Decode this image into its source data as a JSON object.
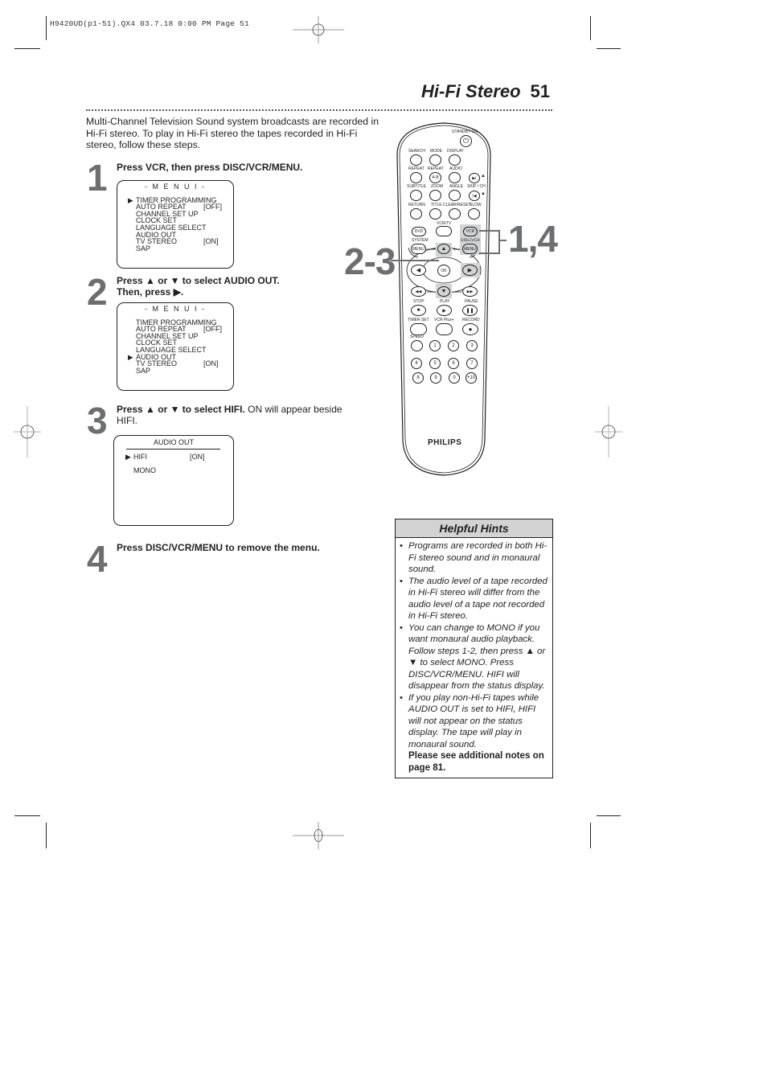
{
  "slug": "H9420UD(p1-51).QX4  03.7.18  0:00 PM  Page 51",
  "header": {
    "title": "Hi-Fi Stereo",
    "page_number": "51"
  },
  "intro": "Multi-Channel Television Sound system broadcasts are recorded in Hi-Fi stereo. To play in Hi-Fi stereo the tapes recorded in Hi-Fi stereo, follow these steps.",
  "steps": [
    {
      "number": "1",
      "text_bold": "Press VCR, then press DISC/VCR/MENU.",
      "text_normal": ""
    },
    {
      "number": "2",
      "text_bold": "Press ▲ or ▼ to select AUDIO OUT.",
      "text_bold2": "Then, press ▶.",
      "text_normal": ""
    },
    {
      "number": "3",
      "text_bold": "Press ▲ or ▼ to select HIFI.",
      "text_normal": " ON will appear beside",
      "text_normal2": "HIFI."
    },
    {
      "number": "4",
      "text_bold": "Press DISC/VCR/MENU to remove the menu.",
      "text_normal": ""
    }
  ],
  "menu1": {
    "heading": "- M E N U  I -",
    "pointer": "▶",
    "items": [
      {
        "label": "TIMER PROGRAMMING",
        "value": ""
      },
      {
        "label": "AUTO REPEAT",
        "value": "[OFF]"
      },
      {
        "label": "CHANNEL SET UP",
        "value": ""
      },
      {
        "label": "CLOCK SET",
        "value": ""
      },
      {
        "label": "LANGUAGE SELECT",
        "value": ""
      },
      {
        "label": "AUDIO OUT",
        "value": ""
      },
      {
        "label": "TV STEREO",
        "value": "[ON]"
      },
      {
        "label": "SAP",
        "value": ""
      }
    ],
    "selected_step1": 0,
    "selected_step2": 5
  },
  "audio_menu": {
    "heading": "AUDIO OUT",
    "pointer": "▶",
    "items": [
      {
        "label": "HIFI",
        "value": "[ON]"
      },
      {
        "label": "MONO",
        "value": ""
      }
    ],
    "selected": 0
  },
  "remote": {
    "brand": "PHILIPS",
    "labels": {
      "standby": "STANDBY-ON",
      "search": "SEARCH",
      "mode": "MODE",
      "display": "DISPLAY",
      "repeat1": "REPEAT",
      "repeat2": "REPEAT",
      "audio": "AUDIO",
      "ab": "A-B",
      "subtitle": "SUBTITLE",
      "zoom": "ZOOM",
      "angle": "ANGLE",
      "skip_ch": "SKIP / CH",
      "return": "RETURN",
      "title": "TITLE",
      "clear_reset": "CLEAR/RESET",
      "slow": "SLOW",
      "vcr_tv": "VCR/TV",
      "dvd": "DVD",
      "vcr": "VCR",
      "system": "SYSTEM",
      "disc_vcr": "DISC/VCR",
      "menu": "MENU",
      "ok": "OK",
      "stop": "STOP",
      "play": "PLAY",
      "pause": "PAUSE",
      "timer_set": "TIMER SET",
      "vcr_plus": "VCR Plus+",
      "record": "RECORD",
      "speed": "SPEED"
    },
    "number_keys": [
      "1",
      "2",
      "3",
      "4",
      "5",
      "6",
      "7",
      "8",
      "9",
      "0",
      "+10"
    ],
    "callouts": {
      "left": "2-3",
      "right": "1,4"
    }
  },
  "hints": {
    "title": "Helpful Hints",
    "items": [
      "Programs are recorded in both Hi-Fi stereo sound and in monaural sound.",
      "The audio level of a tape recorded in Hi-Fi stereo will differ from the audio level of a tape not recorded in Hi-Fi stereo.",
      "You can change to MONO if you want monaural audio playback. Follow steps 1-2, then press ▲ or ▼ to select MONO. Press DISC/VCR/MENU. HIFI will disappear from the status display.",
      "If you play non-Hi-Fi tapes while AUDIO OUT is set to HIFI, HIFI will not appear on the status display. The tape will play in monaural sound."
    ],
    "note": "Please see additional notes on page 81.",
    "bullet": "•"
  }
}
